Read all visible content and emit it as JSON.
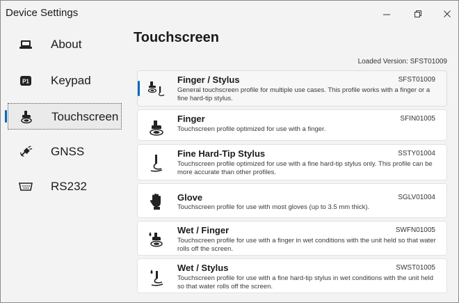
{
  "window": {
    "title": "Device Settings"
  },
  "sidebar": {
    "items": [
      {
        "label": "About",
        "icon": "laptop-icon",
        "active": false
      },
      {
        "label": "Keypad",
        "icon": "p1-key-icon",
        "active": false
      },
      {
        "label": "Touchscreen",
        "icon": "touch-icon",
        "active": true
      },
      {
        "label": "GNSS",
        "icon": "satellite-icon",
        "active": false
      },
      {
        "label": "RS232",
        "icon": "serial-port-icon",
        "active": false
      }
    ]
  },
  "main": {
    "title": "Touchscreen",
    "loaded_version": "Loaded Version: SFST01009",
    "profiles": [
      {
        "name": "Finger / Stylus",
        "code": "SFST01009",
        "description": "General touchscreen profile for multiple use cases. This profile works with a finger or a fine hard-tip stylus.",
        "icon": "finger-stylus-icon",
        "selected": true
      },
      {
        "name": "Finger",
        "code": "SFIN01005",
        "description": "Touchscreen profile optimized for use with a finger.",
        "icon": "finger-touch-icon",
        "selected": false
      },
      {
        "name": "Fine Hard-Tip Stylus",
        "code": "SSTY01004",
        "description": "Touchscreen profile optimized for use with a fine hard-tip stylus only. This profile can be more accurate than other profiles.",
        "icon": "stylus-icon",
        "selected": false
      },
      {
        "name": "Glove",
        "code": "SGLV01004",
        "description": "Touchscreen profile for use with most gloves (up to 3.5 mm thick).",
        "icon": "glove-icon",
        "selected": false
      },
      {
        "name": "Wet / Finger",
        "code": "SWFN01005",
        "description": "Touchscreen profile for use with a finger in wet conditions with the unit held so that water rolls off the screen.",
        "icon": "wet-finger-icon",
        "selected": false
      },
      {
        "name": "Wet / Stylus",
        "code": "SWST01005",
        "description": "Touchscreen profile for use with a fine hard-tip stylus in wet conditions with the unit held so that water rolls off the screen.",
        "icon": "wet-stylus-icon",
        "selected": false
      }
    ]
  },
  "colors": {
    "accent": "#0067c0",
    "sidebar_bg": "#f3f3f3",
    "card_bg": "#ffffff"
  }
}
